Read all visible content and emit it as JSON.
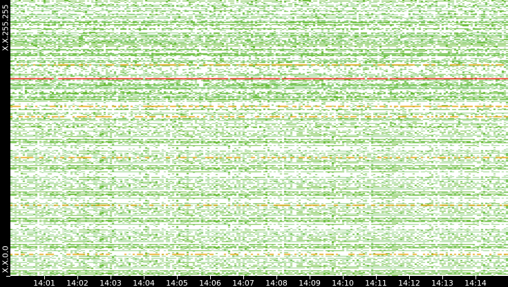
{
  "chart_data": {
    "type": "heatmap",
    "title": "",
    "xlabel": "",
    "ylabel": "",
    "y_tick_labels": [
      "X.X.255.255",
      "X.X.0.0"
    ],
    "x_tick_labels": [
      "14:01",
      "14:02",
      "14:03",
      "14:04",
      "14:05",
      "14:06",
      "14:07",
      "14:08",
      "14:09",
      "14:10",
      "14:11",
      "14:12",
      "14:13",
      "14:14"
    ],
    "x_range": [
      "14:00",
      "14:15"
    ],
    "colors": {
      "low": "#8fd07e",
      "mid": "#66bb33",
      "high": "#e8a000",
      "max": "#ff2020",
      "background": "#ffffff"
    },
    "highlighted_rows": [
      {
        "row_fraction_from_top": 0.233,
        "level": "high"
      },
      {
        "row_fraction_from_top": 0.283,
        "level": "max"
      },
      {
        "row_fraction_from_top": 0.384,
        "level": "high"
      },
      {
        "row_fraction_from_top": 0.42,
        "level": "high"
      },
      {
        "row_fraction_from_top": 0.57,
        "level": "high"
      },
      {
        "row_fraction_from_top": 0.742,
        "level": "high"
      },
      {
        "row_fraction_from_top": 0.92,
        "level": "high"
      }
    ]
  }
}
